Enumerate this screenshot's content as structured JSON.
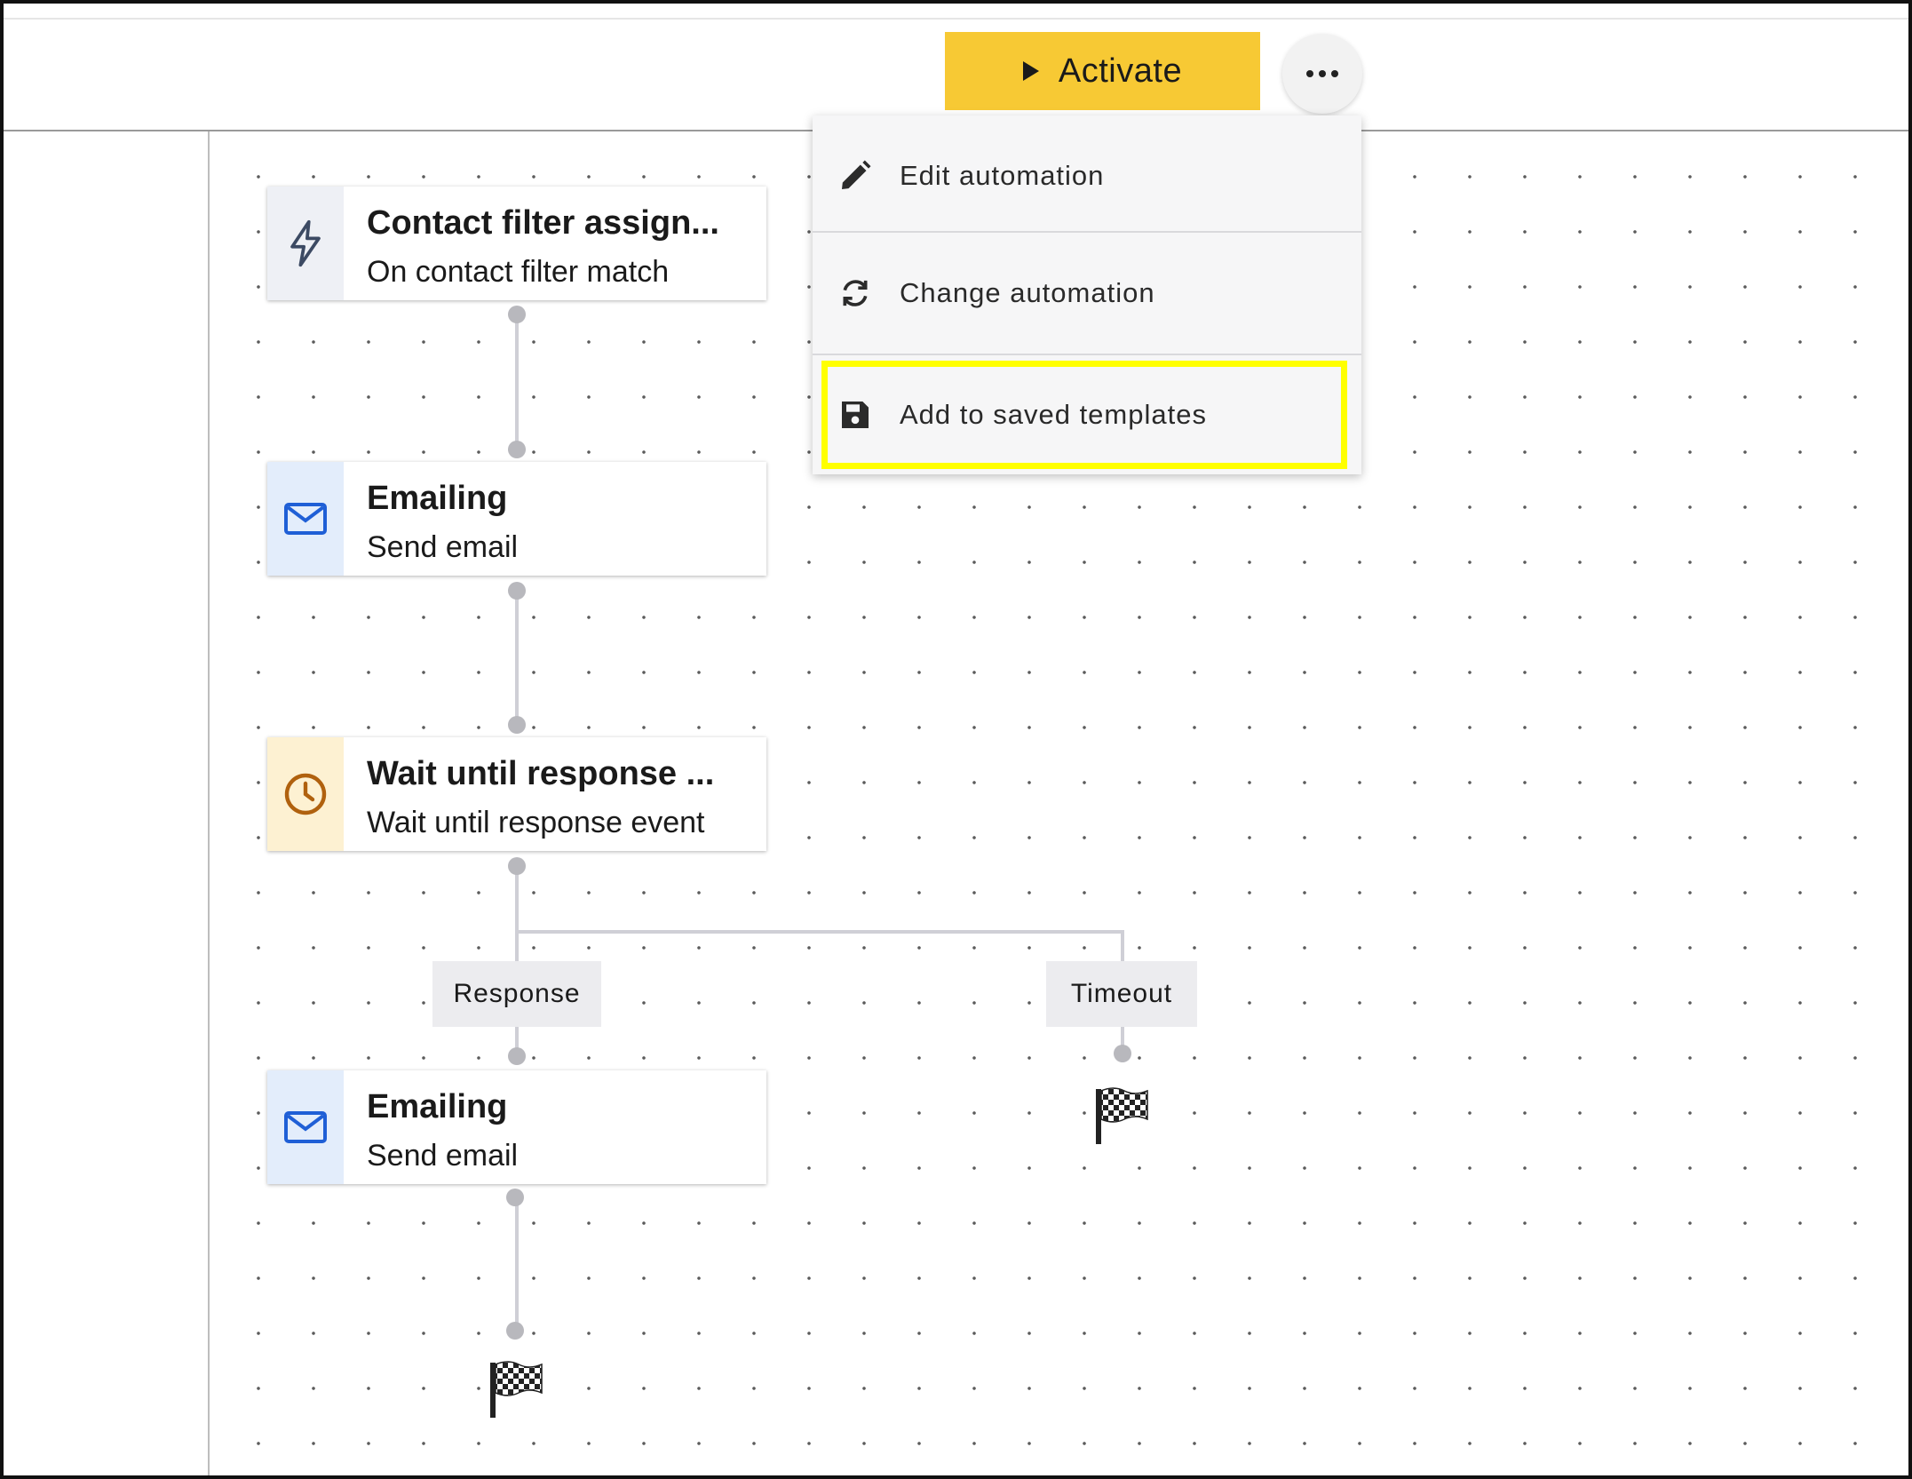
{
  "header": {
    "activate_label": "Activate",
    "more_label": "More options"
  },
  "menu": {
    "items": [
      {
        "label": "Edit automation",
        "icon": "pencil-icon"
      },
      {
        "label": "Change automation",
        "icon": "refresh-icon"
      },
      {
        "label": "Add to saved templates",
        "icon": "save-icon",
        "highlighted": true
      }
    ],
    "highlight_color": "#ffff00"
  },
  "workflow": {
    "nodes": [
      {
        "title": "Contact filter assign...",
        "subtitle": "On contact filter match",
        "icon": "lightning-icon",
        "icon_bg": "#eef0f5"
      },
      {
        "title": "Emailing",
        "subtitle": "Send email",
        "icon": "mail-icon",
        "icon_bg": "#e3edfb"
      },
      {
        "title": "Wait until response ...",
        "subtitle": "Wait until response event",
        "icon": "clock-icon",
        "icon_bg": "#fdf1d2"
      },
      {
        "title": "Emailing",
        "subtitle": "Send email",
        "icon": "mail-icon",
        "icon_bg": "#e3edfb"
      }
    ],
    "branches": [
      {
        "label": "Response"
      },
      {
        "label": "Timeout"
      }
    ],
    "end_icon": "finish-flag-icon"
  },
  "colors": {
    "activate": "#f7c934",
    "connector": "#cfcfd6"
  }
}
